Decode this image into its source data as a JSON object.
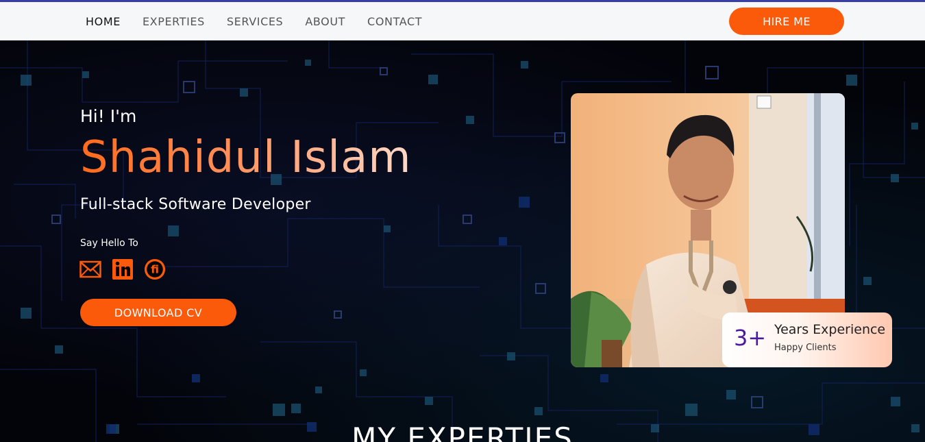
{
  "nav": {
    "links": [
      "HOME",
      "EXPERTIES",
      "SERVICES",
      "ABOUT",
      "CONTACT"
    ],
    "hire_label": "HIRE ME"
  },
  "hero": {
    "greeting": "Hi! I'm",
    "name": "Shahidul Islam",
    "role": "Full-stack Software Developer",
    "say_hello": "Say Hello To",
    "socials": [
      "mail-icon",
      "linkedin-icon",
      "fiverr-icon"
    ],
    "download_label": "DOWNLOAD CV"
  },
  "experience": {
    "number": "3+",
    "title": "Years Experience",
    "subtitle": "Happy Clients"
  },
  "section": {
    "title": "MY EXPERTIES"
  },
  "colors": {
    "accent": "#fb5a0a",
    "nav_bg": "#f6f7f9",
    "top_line": "#3a3fa8",
    "number": "#4a1aa0"
  }
}
